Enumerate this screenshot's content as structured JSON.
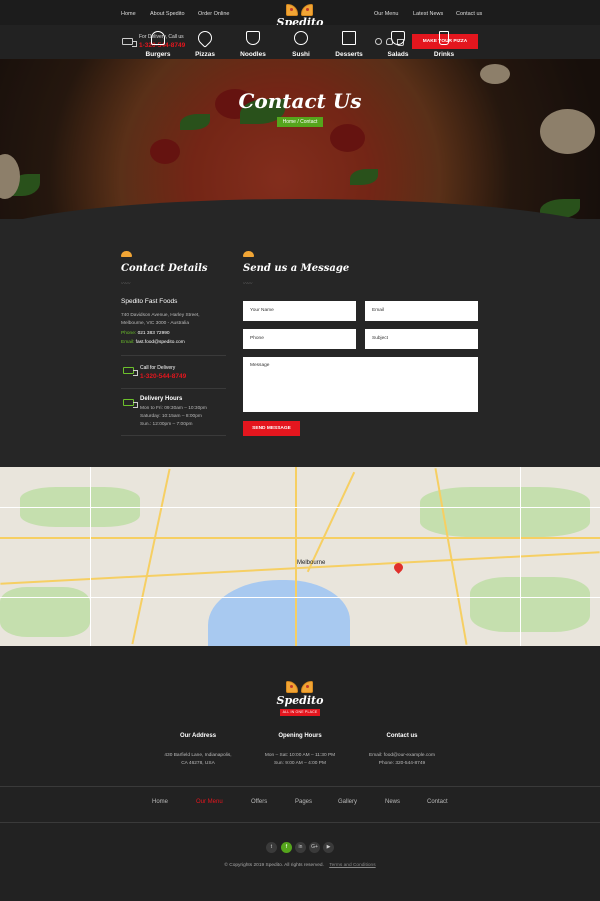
{
  "nav": {
    "left": [
      "Home",
      "About Spedito",
      "Order Online"
    ],
    "right": [
      "Our Menu",
      "Latest News",
      "Contact us"
    ]
  },
  "logo": {
    "name": "Spedito",
    "tagline": "ALL IN ONE PLACE"
  },
  "delivery": {
    "label": "For Delivery, Call us",
    "phone": "1-320-544-8749"
  },
  "header_icons": [
    "search-icon",
    "user-icon",
    "cart-icon"
  ],
  "cta": {
    "make_pizza": "MAKE YOUR PIZZA"
  },
  "categories": [
    "Burgers",
    "Pizzas",
    "Noodles",
    "Sushi",
    "Desserts",
    "Salads",
    "Drinks"
  ],
  "hero": {
    "title": "Contact Us",
    "breadcrumb": "Home  /  Contact"
  },
  "contact_details": {
    "title": "Contact Details",
    "company": "Spedito Fast Foods",
    "address_line1": "740 Davidson Avenue, Harley Street,",
    "address_line2": "Melbourne, VIC 3000 - Australia",
    "phone_label": "Phone:",
    "phone": "021 383 72990",
    "email_label": "Email:",
    "email": "fast.food@spedito.com",
    "call_label": "Call for Delivery",
    "call_phone": "1-320-544-8749",
    "hours_title": "Delivery Hours",
    "hours": [
      "Mon to Fri: 09:30am – 10:30pm",
      "Saturday: 10:15am – 8:00pm",
      "Sun.: 12:00pm – 7:00pm"
    ]
  },
  "message_form": {
    "title": "Send us a Message",
    "name_placeholder": "Your Name",
    "email_placeholder": "Email",
    "phone_placeholder": "Phone",
    "subject_placeholder": "Subject",
    "message_placeholder": "Message",
    "submit": "SEND MESSAGE"
  },
  "map": {
    "city_label": "Melbourne"
  },
  "footer": {
    "address_title": "Our Address",
    "address_lines": [
      "430 Barfield Lane, Indianapolis,",
      "CA 46278, USA"
    ],
    "hours_title": "Opening Hours",
    "hours_lines": [
      "Mon – Sat: 10:00 AM – 11:30 PM",
      "Sun: 9:00 AM – 4:00 PM"
    ],
    "contact_title": "Contact us",
    "contact_lines": [
      "Email: food@our-example.com",
      "Phone: 320-544-8749"
    ],
    "nav": [
      "Home",
      "Our Menu",
      "Offers",
      "Pages",
      "Gallery",
      "News",
      "Contact"
    ],
    "social": [
      "t",
      "f",
      "in",
      "G+",
      "▶"
    ],
    "copyright": "© Copyrights 2019 Spedito. All rights reserved.",
    "terms": "Terms and Conditions"
  },
  "colors": {
    "accent_red": "#e4161e",
    "accent_green": "#55a51c",
    "bg_dark": "#262626"
  }
}
